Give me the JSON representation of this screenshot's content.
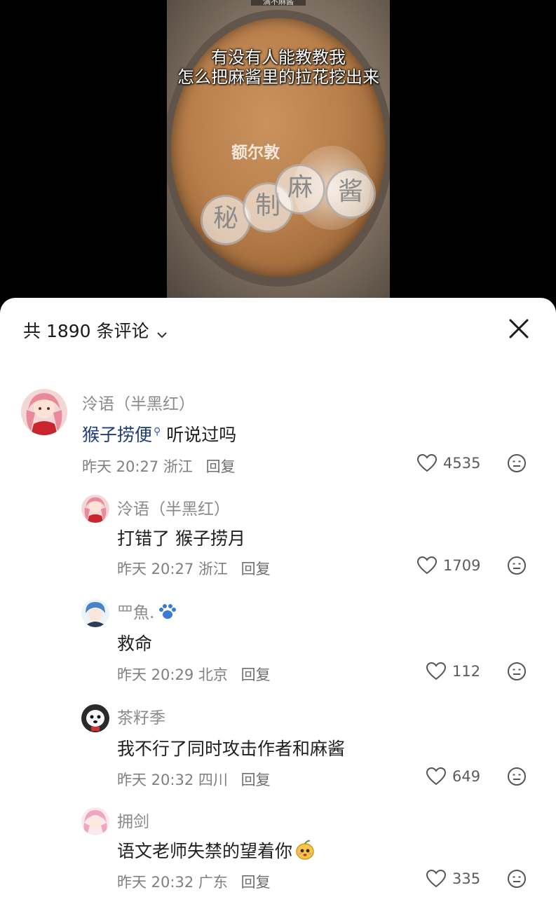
{
  "video": {
    "top_label": "满不麻酱",
    "caption_line1": "有没有人能教教我",
    "caption_line2": "怎么把麻酱里的拉花挖出来",
    "brand": "额尔敦",
    "watermark_chars": [
      "秘",
      "制",
      "麻",
      "酱"
    ]
  },
  "comments_header": {
    "title": "共 1890 条评论"
  },
  "comments": [
    {
      "username": "泠语（半黑红）",
      "link_text": "猴子捞便",
      "text": " 听说过吗",
      "time": "昨天 20:27",
      "location": "浙江",
      "reply_label": "回复",
      "likes": "4535"
    },
    {
      "username": "泠语（半黑红）",
      "text": "打错了 猴子捞月",
      "time": "昨天 20:27",
      "location": "浙江",
      "reply_label": "回复",
      "likes": "1709"
    },
    {
      "username": "罒魚.",
      "text": "救命",
      "time": "昨天 20:29",
      "location": "北京",
      "reply_label": "回复",
      "likes": "112"
    },
    {
      "username": "茶籽季",
      "text": "我不行了同时攻击作者和麻酱",
      "time": "昨天 20:32",
      "location": "四川",
      "reply_label": "回复",
      "likes": "649"
    },
    {
      "username": "拥剑",
      "text": "语文老师失禁的望着你",
      "time": "昨天 20:32",
      "location": "广东",
      "reply_label": "回复",
      "likes": "335"
    }
  ],
  "colors": {
    "sheet_bg": "#ffffff",
    "username": "#8a8a8a",
    "text": "#1f1f1f",
    "meta": "#7f7f7f",
    "link": "#1f3c7a"
  },
  "icons": [
    "chevron-down-icon",
    "close-icon",
    "heart-icon",
    "meh-face-icon",
    "search-hint-icon",
    "paw-icon",
    "mango-emoji-icon"
  ]
}
